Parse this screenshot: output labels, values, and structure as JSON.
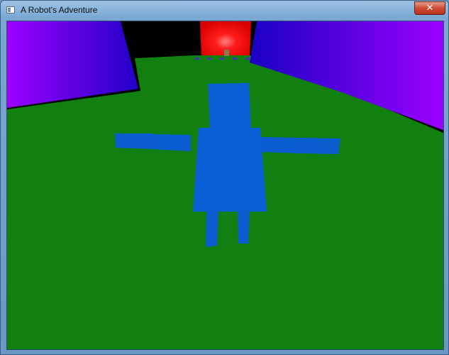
{
  "window": {
    "title": "A Robot's Adventure",
    "close_glyph": "✕"
  },
  "scene": {
    "sky_color": "#000000",
    "ground_color": "#118011",
    "wall_gradient": [
      "#9a00ff",
      "#1f00c8"
    ],
    "far_wall_color": "#ff1a1a",
    "robot_color": "#0a5ed3",
    "icons": {
      "app": "window-app-icon",
      "close": "close-icon"
    }
  }
}
